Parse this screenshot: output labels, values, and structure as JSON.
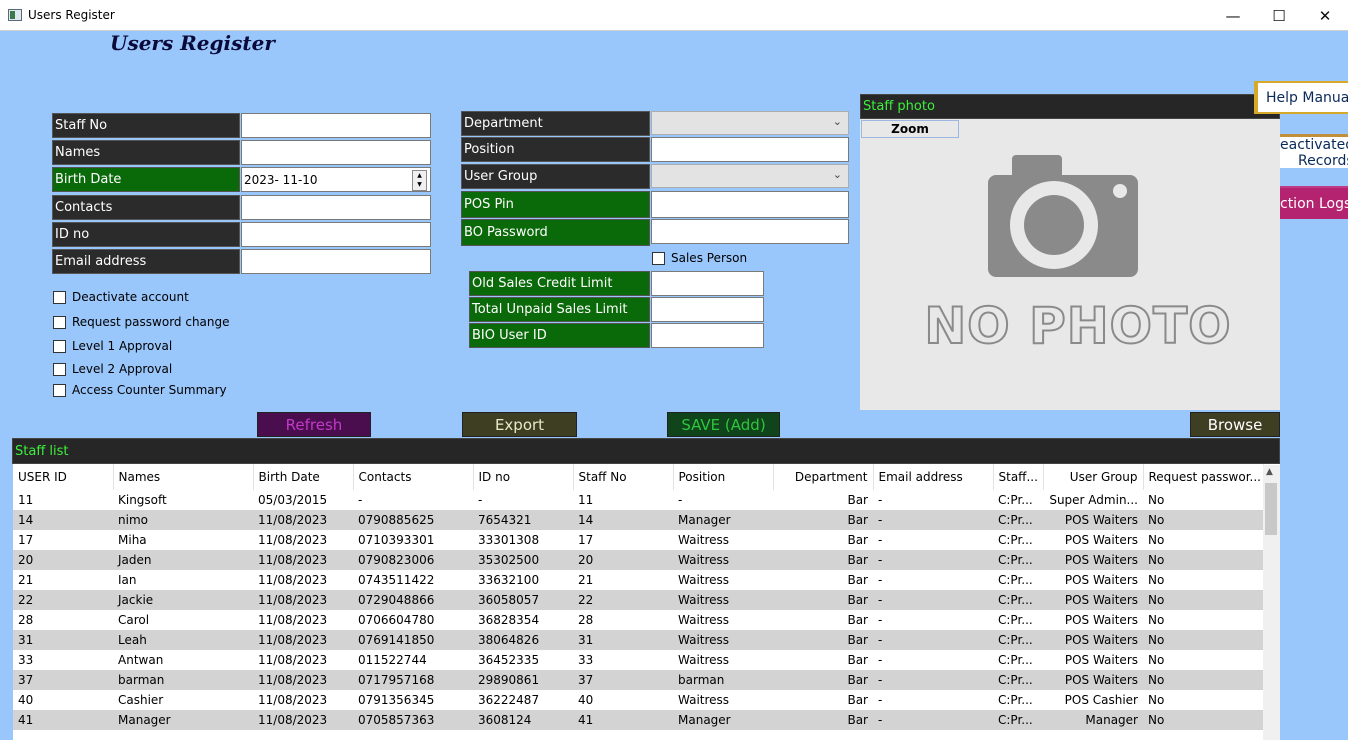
{
  "window": {
    "title": "Users Register",
    "controls": [
      "—",
      "☐",
      "✕"
    ]
  },
  "heading": "Users Register",
  "left_fields": [
    {
      "label": "Staff No",
      "value": "",
      "green": false
    },
    {
      "label": "Names",
      "value": "",
      "green": false
    },
    {
      "label": "Birth Date",
      "value": "2023- 11-10",
      "green": true
    },
    {
      "label": "Contacts",
      "value": "",
      "green": false
    },
    {
      "label": "ID no",
      "value": "",
      "green": false
    },
    {
      "label": "Email address",
      "value": "",
      "green": false
    }
  ],
  "checkboxes": [
    "Deactivate account",
    "Request password change",
    "Level 1 Approval",
    "Level 2 Approval",
    "Access Counter Summary"
  ],
  "middle_fields": {
    "department": "Department",
    "position": "Position",
    "user_group": "User Group",
    "pos_pin": "POS Pin",
    "bo_password": "BO Password",
    "sales_person": "Sales Person",
    "old_credit": "Old Sales Credit Limit",
    "unpaid_limit": "Total Unpaid Sales Limit",
    "bio_id": "BIO User ID"
  },
  "photo": {
    "header": "Staff photo",
    "zoom": "Zoom",
    "placeholder": "NO PHOTO"
  },
  "side_buttons": {
    "help": "Help Manual",
    "deactivated_line1": "eactivated",
    "deactivated_line2": "Records",
    "logs": "ction Logs"
  },
  "buttons": {
    "refresh": "Refresh",
    "export": "Export",
    "save": "SAVE (Add)",
    "browse": "Browse"
  },
  "colors": {
    "refresh_bg": "#4a0d4e",
    "refresh_fg": "#c23ac8",
    "export_bg": "#3e3e22",
    "export_fg": "#e9e9c9",
    "save_bg": "#10441a",
    "save_fg": "#2fc53f",
    "browse_bg": "#3e3e22",
    "browse_fg": "#ffffff"
  },
  "staff_list": {
    "title": "Staff list",
    "columns": [
      "USER ID",
      "Names",
      "Birth Date",
      "Contacts",
      "ID no",
      "Staff No",
      "Position",
      "Department",
      "Email address",
      "Staff...",
      "User Group",
      "Request passwor..."
    ],
    "rows": [
      [
        "11",
        "Kingsoft",
        "05/03/2015",
        "-",
        "-",
        "11",
        "-",
        "Bar",
        "-",
        "C:Pr...",
        "Super Admin...",
        "No"
      ],
      [
        "14",
        "nimo",
        "11/08/2023",
        "0790885625",
        "7654321",
        "14",
        "Manager",
        "Bar",
        "-",
        "C:Pr...",
        "POS Waiters",
        "No"
      ],
      [
        "17",
        "Miha",
        "11/08/2023",
        "0710393301",
        "33301308",
        "17",
        "Waitress",
        "Bar",
        "-",
        "C:Pr...",
        "POS Waiters",
        "No"
      ],
      [
        "20",
        "Jaden",
        "11/08/2023",
        "0790823006",
        "35302500",
        "20",
        "Waitress",
        "Bar",
        "-",
        "C:Pr...",
        "POS Waiters",
        "No"
      ],
      [
        "21",
        "Ian",
        "11/08/2023",
        "0743511422",
        "33632100",
        "21",
        "Waitress",
        "Bar",
        "-",
        "C:Pr...",
        "POS Waiters",
        "No"
      ],
      [
        "22",
        "Jackie",
        "11/08/2023",
        "0729048866",
        "36058057",
        "22",
        "Waitress",
        "Bar",
        "-",
        "C:Pr...",
        "POS Waiters",
        "No"
      ],
      [
        "28",
        "Carol",
        "11/08/2023",
        "0706604780",
        "36828354",
        "28",
        "Waitress",
        "Bar",
        "-",
        "C:Pr...",
        "POS Waiters",
        "No"
      ],
      [
        "31",
        "Leah",
        "11/08/2023",
        "0769141850",
        "38064826",
        "31",
        "Waitress",
        "Bar",
        "-",
        "C:Pr...",
        "POS Waiters",
        "No"
      ],
      [
        "33",
        "Antwan",
        "11/08/2023",
        "011522744",
        "36452335",
        "33",
        "Waitress",
        "Bar",
        "-",
        "C:Pr...",
        "POS Waiters",
        "No"
      ],
      [
        "37",
        "barman",
        "11/08/2023",
        "0717957168",
        "29890861",
        "37",
        "barman",
        "Bar",
        "-",
        "C:Pr...",
        "POS Waiters",
        "No"
      ],
      [
        "40",
        "Cashier",
        "11/08/2023",
        "0791356345",
        "36222487",
        "40",
        "Waitress",
        "Bar",
        "-",
        "C:Pr...",
        "POS Cashier",
        "No"
      ],
      [
        "41",
        "Manager",
        "11/08/2023",
        "0705857363",
        "3608124",
        "41",
        "Manager",
        "Bar",
        "-",
        "C:Pr...",
        "Manager",
        "No"
      ]
    ]
  }
}
